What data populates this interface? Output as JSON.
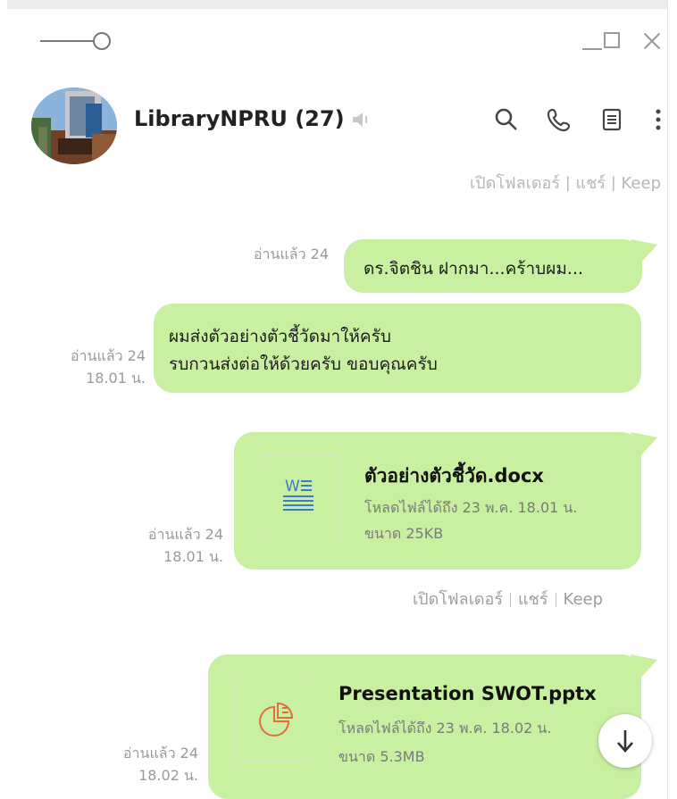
{
  "header": {
    "chat_name": "LibraryNPRU (27)"
  },
  "previous_file_actions": "เปิดโฟลเดอร์ | แชร์ | Keep",
  "messages": [
    {
      "text_lines": [
        "ดร.จิตชิน ฝากมา...คร้าบผม..."
      ],
      "read_status": "อ่านแล้ว 24",
      "time": ""
    },
    {
      "text_lines": [
        "ผมส่งตัวอย่างตัวชี้วัดมาให้ครับ",
        "รบกวนส่งต่อให้ด้วยครับ ขอบคุณครับ"
      ],
      "read_status": "อ่านแล้ว 24",
      "time": "18.01 น."
    },
    {
      "file_name": "ตัวอย่างตัวชี้วัด.docx",
      "download_info": "โหลดไฟล์ได้ถึง 23 พ.ค. 18.01 น.",
      "size_info": "ขนาด 25KB",
      "read_status": "อ่านแล้ว 24",
      "time": "18.01 น.",
      "icon": "word-doc-icon"
    },
    {
      "file_name": "Presentation SWOT.pptx",
      "download_info": "โหลดไฟล์ได้ถึง 23 พ.ค. 18.02 น.",
      "size_info": "ขนาด 5.3MB",
      "read_status": "อ่านแล้ว 24",
      "time": "18.02 น.",
      "icon": "pptx-chart-icon"
    }
  ],
  "file_actions": {
    "open_folder": "เปิดโฟลเดอร์",
    "share": "แชร์",
    "keep": "Keep"
  },
  "colors": {
    "bubble": "#c9f0a0",
    "meta_text": "#9a9a9a"
  }
}
